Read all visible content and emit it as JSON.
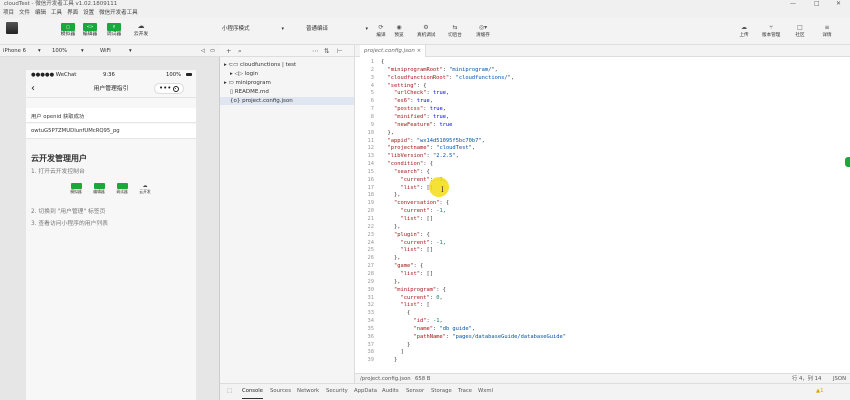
{
  "window": {
    "title": "cloudTest - 微信开发者工具 v1.02.1809111",
    "controls": [
      "—",
      "□",
      "✕"
    ]
  },
  "menu": [
    "项目",
    "文件",
    "编辑",
    "工具",
    "界面",
    "设置",
    "微信开发者工具"
  ],
  "toolbar": {
    "left_buttons": [
      {
        "label": "模拟器",
        "badge": "□"
      },
      {
        "label": "编辑器",
        "badge": "<>"
      },
      {
        "label": "调试器",
        "badge": "⚲"
      },
      {
        "label": "云开发",
        "icon": "cloud-dev-icon",
        "glyph": "☁"
      }
    ],
    "mode_select": "小程序模式",
    "compile_select": "普通编译",
    "center_tools": [
      {
        "label": "编译",
        "glyph": "⟳"
      },
      {
        "label": "预览",
        "glyph": "◉"
      },
      {
        "label": "真机调试",
        "glyph": "⚙"
      },
      {
        "label": "切后台",
        "glyph": "⇆"
      },
      {
        "label": "清缓存",
        "glyph": "◎▾"
      }
    ],
    "right_tools": [
      {
        "label": "上传",
        "glyph": "☁"
      },
      {
        "label": "版本管理",
        "glyph": "⑂"
      },
      {
        "label": "社区",
        "glyph": "□"
      },
      {
        "label": "详情",
        "glyph": "≡"
      }
    ]
  },
  "simulator_bar": {
    "device": "iPhone 6",
    "zoom": "100%",
    "network": "WiFi",
    "icons": [
      "◁",
      "▭"
    ]
  },
  "phone": {
    "status": {
      "carrier": "●●●●● WeChat",
      "time": "9:36",
      "battery": "100%"
    },
    "nav_title": "用户管理指引",
    "rows": [
      "用户 openid 获取成功",
      "owtuG5P7ZMUDIunfUMcRQ95_pg"
    ],
    "heading": "云开发管理用户",
    "steps": [
      "1. 打开云开发控制台",
      "2. 切换到 \"用户管理\" 标签页",
      "3. 查看访问小程序的用户列表"
    ],
    "mini_tools": [
      "模拟器",
      "编辑器",
      "调试器",
      "云开发"
    ]
  },
  "explorer": {
    "tools": [
      "+",
      "⌕",
      "⋯",
      "⇅",
      "⊢"
    ],
    "items": [
      {
        "label": "▸ ⊂▭ cloudfunctions | test",
        "indent": 0
      },
      {
        "label": "▸ ◁▷ login",
        "indent": 1
      },
      {
        "label": "▸ ▭ miniprogram",
        "indent": 0
      },
      {
        "label": "▯ README.md",
        "indent": 1
      },
      {
        "label": "{o} project.config.json",
        "indent": 1
      }
    ]
  },
  "editor": {
    "tab": "project.config.json  ×",
    "lines": [
      "{",
      "  \"miniprogramRoot\": \"miniprogram/\",",
      "  \"cloudfunctionRoot\": \"cloudfunctions/\",",
      "  \"setting\": {",
      "    \"urlCheck\": true,",
      "    \"es6\": true,",
      "    \"postcss\": true,",
      "    \"minified\": true,",
      "    \"newFeature\": true",
      "  },",
      "  \"appid\": \"wx14d51095f5bc70b7\",",
      "  \"projectname\": \"cloudTest\",",
      "  \"libVersion\": \"2.2.5\",",
      "  \"condition\": {",
      "    \"search\": {",
      "      \"current\": -1,",
      "      \"list\": []",
      "    },",
      "    \"conversation\": {",
      "      \"current\": -1,",
      "      \"list\": []",
      "    },",
      "    \"plugin\": {",
      "      \"current\": -1,",
      "      \"list\": []",
      "    },",
      "    \"game\": {",
      "      \"list\": []",
      "    },",
      "    \"miniprogram\": {",
      "      \"current\": 0,",
      "      \"list\": [",
      "        {",
      "          \"id\": -1,",
      "          \"name\": \"db guide\",",
      "          \"pathName\": \"pages/databaseGuide/databaseGuide\"",
      "        }",
      "      ]",
      "    }"
    ]
  },
  "statusbar": {
    "path": "/project.config.json",
    "size": "658 B",
    "position": "行 4，列 14",
    "lang": "JSON"
  },
  "devtools": {
    "tabs": [
      "Console",
      "Sources",
      "Network",
      "Security",
      "AppData",
      "Audits",
      "Sensor",
      "Storage",
      "Trace",
      "Wxml"
    ],
    "warn": "▲1"
  },
  "colors": {
    "accent": "#19a83a",
    "key": "#a31515",
    "string": "#0451a5",
    "bool": "#0000ff",
    "number": "#098658"
  }
}
